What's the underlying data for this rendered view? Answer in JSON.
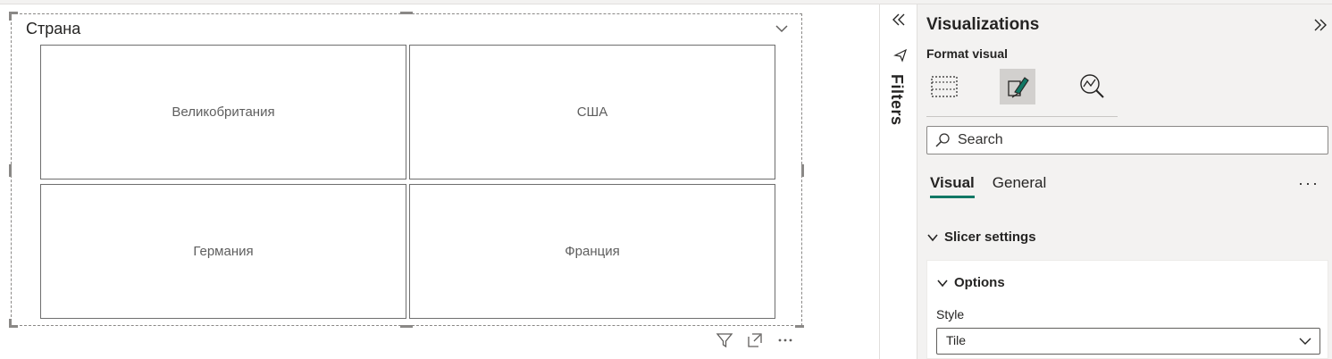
{
  "slicer": {
    "title": "Страна",
    "tiles": [
      "Великобритания",
      "США",
      "Германия",
      "Франция"
    ]
  },
  "filters": {
    "label": "Filters"
  },
  "visualizations": {
    "title": "Visualizations",
    "format_label": "Format visual",
    "search_placeholder": "Search",
    "subtabs": [
      "Visual",
      "General"
    ],
    "more": "···",
    "section": "Slicer settings",
    "card_title": "Options",
    "style_label": "Style",
    "style_value": "Tile"
  },
  "colors": {
    "accent": "#117865",
    "pane_bg": "#f3f2f1",
    "tile_border": "#6e6e6e"
  },
  "icons": [
    "chevron-down-icon",
    "filter-icon",
    "focus-mode-icon",
    "more-options-icon",
    "double-chevron-left-icon",
    "double-chevron-right-icon",
    "build-visual-icon",
    "format-paintbrush-icon",
    "analytics-icon",
    "search-icon"
  ]
}
